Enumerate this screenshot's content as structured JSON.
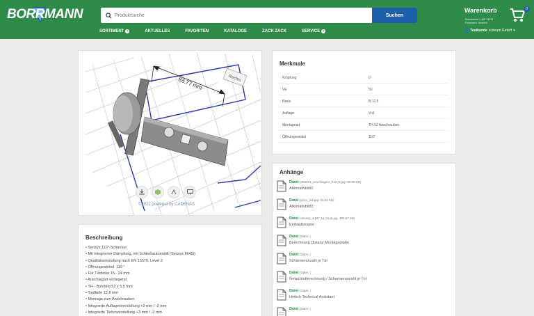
{
  "header": {
    "logo": "BORRMANN",
    "search": {
      "placeholder": "Produktsuche",
      "button": "Suchen"
    },
    "cart": {
      "title": "Warenkorb",
      "line1": "Bornkamm L.60I 11111",
      "line2": "Fernwahl: Ansicht",
      "count": "0"
    },
    "nav": [
      {
        "label": "SORTIMENT",
        "plus": true
      },
      {
        "label": "AKTUELLES",
        "plus": false
      },
      {
        "label": "FAVORITEN",
        "plus": false
      },
      {
        "label": "KATALOGE",
        "plus": false
      },
      {
        "label": "ZACK ZACK",
        "plus": false
      },
      {
        "label": "SERVICE",
        "plus": true
      }
    ],
    "user": {
      "name": "Testkunde",
      "company": "scireum GmbH",
      "caret": "▾"
    }
  },
  "viewer": {
    "dimension": "83.77 mm",
    "label": "Rechts",
    "credit": "©2022 powered by CADENAS",
    "tools": [
      "download-icon",
      "cube-icon",
      "measure-icon",
      "screen-icon"
    ]
  },
  "merkmale": {
    "title": "Merkmale",
    "rows": [
      {
        "key": "Kröpfung",
        "value": "0"
      },
      {
        "key": "VE",
        "value": "50"
      },
      {
        "key": "Basis",
        "value": "B 12,5"
      },
      {
        "key": "Auflage",
        "value": "Voll"
      },
      {
        "key": "Montageart",
        "value": "TH 52 Anschrauben"
      },
      {
        "key": "Öffnungswinkel",
        "value": "110°"
      }
    ]
  },
  "anhaenge": {
    "title": "Anhänge",
    "items": [
      {
        "type": "Datei",
        "meta": "(300201_anschlagam_b12_5.jpg, 39.55 KB)",
        "name": "Alternativbild2"
      },
      {
        "type": "Datei",
        "meta": "(picto_t42.jpg, 33.64 KB)",
        "name": "Alternativbild3"
      },
      {
        "type": "Datei",
        "meta": "(sensys_w107_ta_shop.jpg, 382.67 KB)",
        "name": "Einbaubeispiel"
      },
      {
        "type": "Datei",
        "meta": "(Datei, )",
        "name": "Berechnung Distanz Montageplatte"
      },
      {
        "type": "Datei",
        "meta": "(Datei, )",
        "name": "Scharnieranzahl je Tür"
      },
      {
        "type": "Datei",
        "meta": "(Datei, )",
        "name": "Gewichtsberechnung / Scharnieranzahl je Tür"
      },
      {
        "type": "Datei",
        "meta": "(Datei, )",
        "name": "Hettich Technical Assistant"
      },
      {
        "type": "Datei",
        "meta": "(Datei, )",
        "name": ""
      }
    ]
  },
  "beschreibung": {
    "title": "Beschreibung",
    "items": [
      "Sensys 110°-Scharnier",
      "Mit integrierter Dämpfung, mit Schließautomatik (Sensys 8645i)",
      "Qualitätseinstufung nach EN 15570, Level 3",
      "Öffnungswinkel: 110 °",
      "Für Türdicke 15 - 24 mm",
      "Anschlagart vorliegend",
      "TH - Bohrbild 52 x 5,5 mm",
      "Topftiefe 12,8 mm",
      "Montage zum Anschrauben",
      "Integrierte Auflagenverstellung +2 mm / -2 mm",
      "Integrierte Tiefenverstellung +3 mm / -2 mm"
    ]
  },
  "colors": {
    "brand_green": "#2e8b4a",
    "accent_blue": "#1d5fa8"
  }
}
